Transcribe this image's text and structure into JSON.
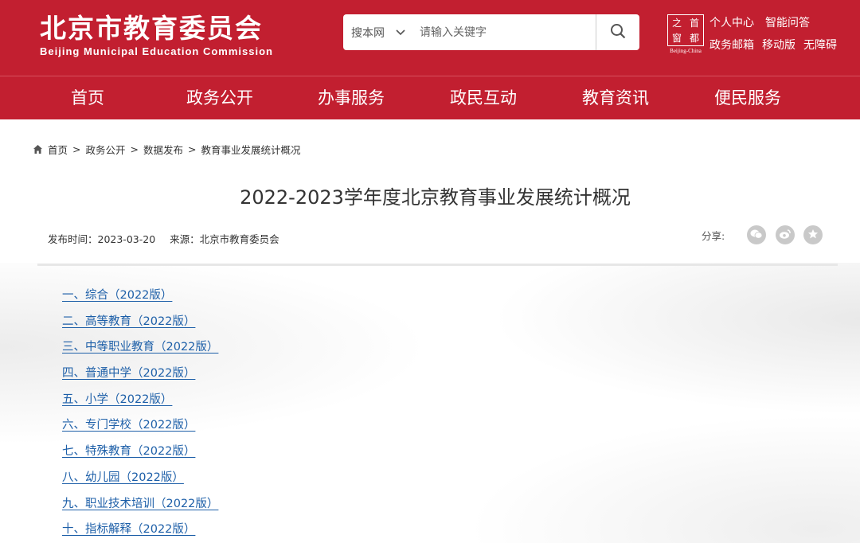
{
  "header": {
    "logo_cn": "北京市教育委员会",
    "logo_en": "Beijing Municipal Education Commission",
    "search": {
      "scope": "搜本网",
      "placeholder": "请输入关键字"
    },
    "emblem": {
      "chars": [
        "之",
        "首",
        "窗",
        "都"
      ],
      "sub": "Beijing-China"
    },
    "links_row1": [
      "个人中心",
      "智能问答"
    ],
    "links_row2": [
      "政务邮箱",
      "移动版",
      "无障碍"
    ]
  },
  "nav": {
    "items": [
      {
        "label": "首页"
      },
      {
        "label": "政务公开"
      },
      {
        "label": "办事服务"
      },
      {
        "label": "政民互动"
      },
      {
        "label": "教育资讯"
      },
      {
        "label": "便民服务"
      }
    ]
  },
  "breadcrumb": {
    "items": [
      "首页",
      "政务公开",
      "数据发布",
      "教育事业发展统计概况"
    ],
    "separator": ">"
  },
  "article": {
    "title": "2022-2023学年度北京教育事业发展统计概况",
    "publish_time": "发布时间：2023-03-20",
    "source": "来源：北京市教育委员会",
    "share_label": "分享:",
    "share_icons": [
      "wechat-icon",
      "weibo-icon",
      "favorite-icon"
    ]
  },
  "toc": [
    "一、综合（2022版）",
    "二、高等教育（2022版）",
    "三、中等职业教育（2022版）",
    "四、普通中学（2022版）",
    "五、小学（2022版）",
    "六、专门学校（2022版）",
    "七、特殊教育（2022版）",
    "八、幼儿园（2022版）",
    "九、职业技术培训（2022版）",
    "十、指标解释（2022版）"
  ],
  "colors": {
    "brand_red": "#c21f30",
    "link_blue": "#1d5fa8"
  }
}
